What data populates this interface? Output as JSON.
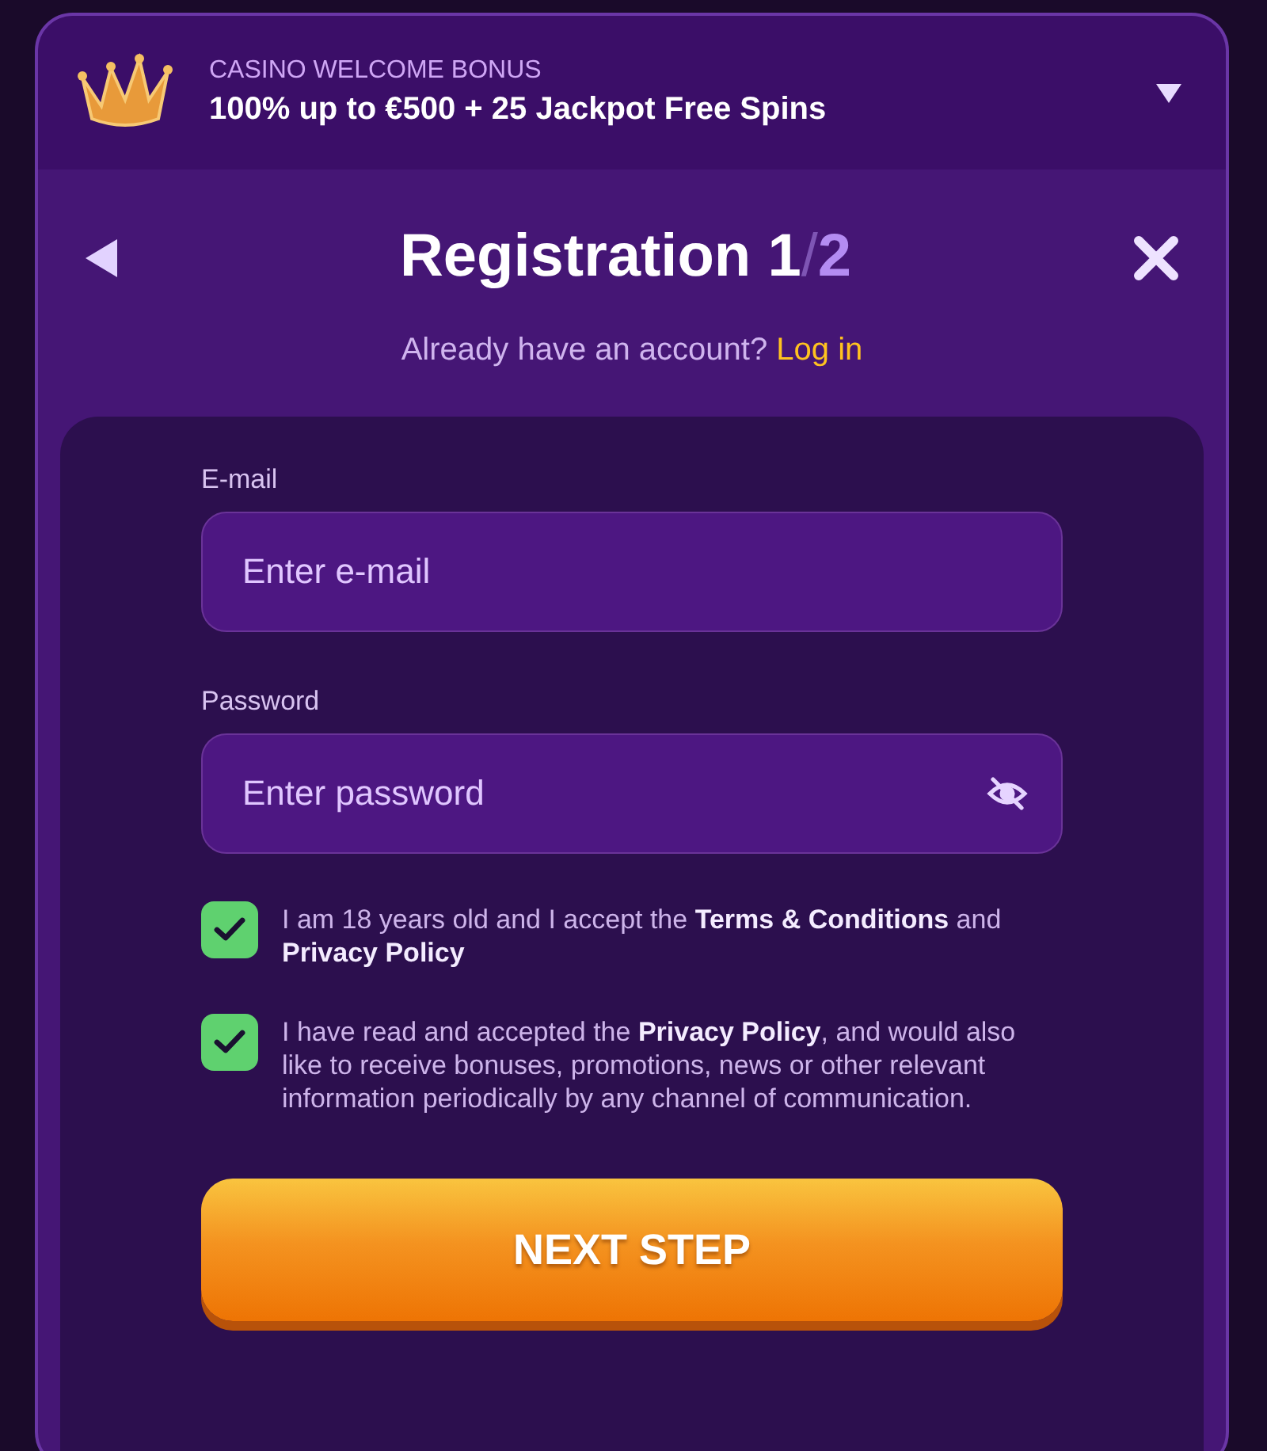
{
  "banner": {
    "eyebrow": "CASINO WELCOME BONUS",
    "offer": "100% up to €500 + 25 Jackpot Free Spins"
  },
  "title": {
    "text": "Registration",
    "step": "1",
    "separator": "/",
    "total": "2"
  },
  "login_prompt": {
    "text": "Already have an account?",
    "link": "Log in"
  },
  "fields": [
    {
      "kind": "email",
      "label": "E-mail",
      "placeholder": "Enter e-mail"
    },
    {
      "kind": "password",
      "label": "Password",
      "placeholder": "Enter password"
    }
  ],
  "consents": [
    {
      "text": "I am 18 years old and I accept the **Terms & Conditions** and **Privacy Policy**",
      "checked": true
    },
    {
      "text": "I have read and accepted the **Privacy Policy**, and would also like to receive bonuses, promotions, news or other relevant information periodically by any channel of communication.",
      "checked": true
    }
  ],
  "submit": "NEXT STEP"
}
